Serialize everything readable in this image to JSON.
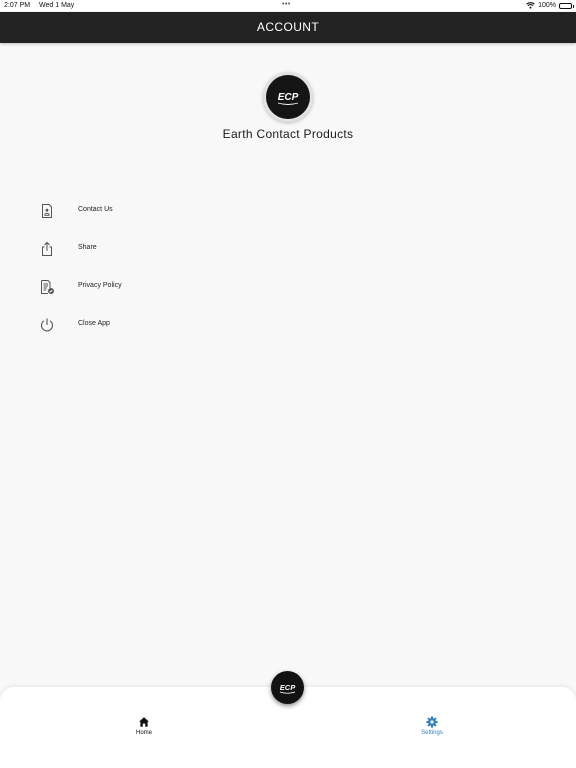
{
  "status_bar": {
    "time": "2:07 PM",
    "date": "Wed 1 May",
    "battery": "100%"
  },
  "header": {
    "title": "ACCOUNT"
  },
  "logo": {
    "text": "ECP"
  },
  "profile": {
    "company_name": "Earth Contact Products"
  },
  "menu": {
    "items": [
      {
        "label": "Contact Us",
        "icon": "contact-document-icon"
      },
      {
        "label": "Share",
        "icon": "share-icon"
      },
      {
        "label": "Privacy Policy",
        "icon": "privacy-policy-icon"
      },
      {
        "label": "Close App",
        "icon": "power-icon"
      }
    ]
  },
  "tab_bar": {
    "home_label": "Home",
    "settings_label": "Settings",
    "center_logo_text": "ECP"
  },
  "colors": {
    "header_bg": "#222222",
    "page_bg": "#f8f8f8",
    "active_tab": "#2e7fc2",
    "logo_bg": "#151515"
  }
}
